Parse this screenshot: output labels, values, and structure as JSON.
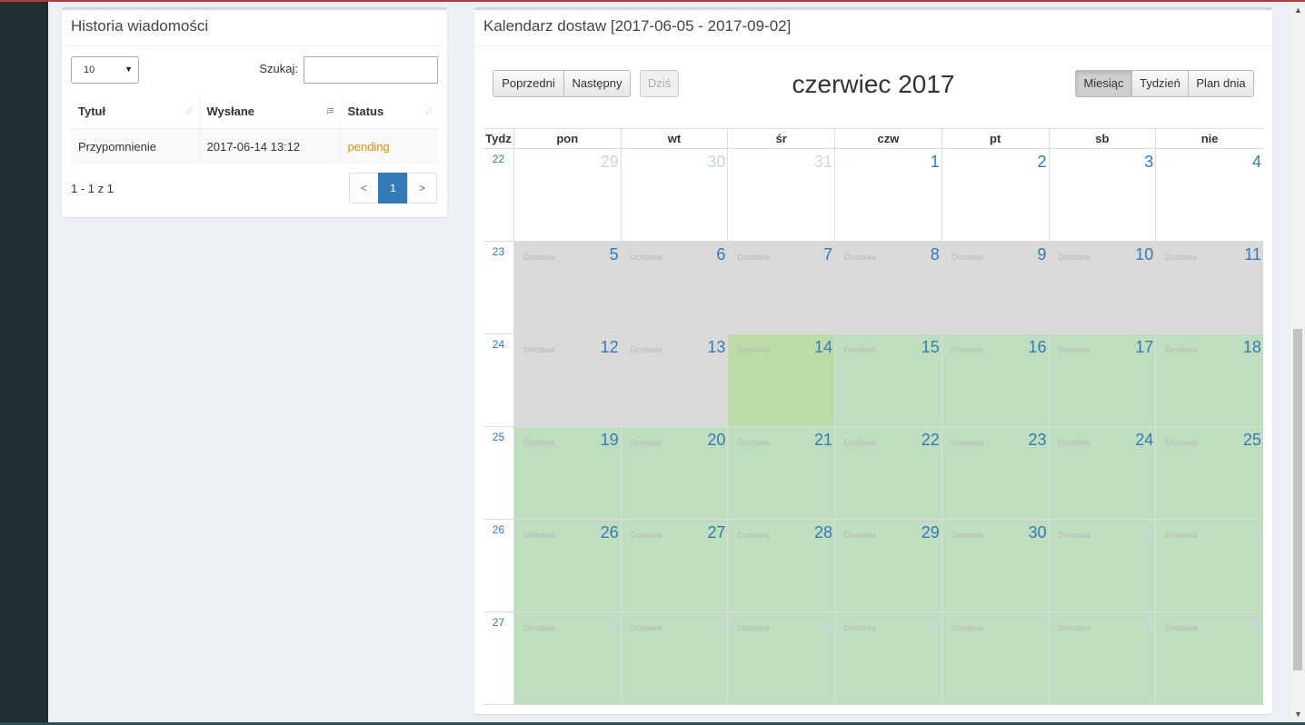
{
  "left_panel": {
    "title": "Historia wiadomości",
    "length_select": "10",
    "search_label": "Szukaj:",
    "search_value": "",
    "columns": [
      "Tytuł",
      "Wysłane",
      "Status"
    ],
    "rows": [
      {
        "title": "Przypomnienie",
        "sent": "2017-06-14 13:12",
        "status": "pending"
      }
    ],
    "info": "1 - 1 z 1",
    "pager": {
      "prev": "<",
      "page": "1",
      "next": ">"
    }
  },
  "calendar": {
    "title": "Kalendarz dostaw [2017-06-05 - 2017-09-02]",
    "month_title": "czerwiec 2017",
    "buttons": {
      "prev": "Poprzedni",
      "next": "Następny",
      "today": "Dziś",
      "month": "Miesiąc",
      "week": "Tydzień",
      "day": "Plan dnia"
    },
    "active_view": "month",
    "week_header": "Tydz",
    "weekdays": [
      "pon",
      "wt",
      "śr",
      "czw",
      "pt",
      "sb",
      "nie"
    ],
    "event_label": "Dostawa",
    "weeks": [
      {
        "no": "22",
        "days": [
          {
            "d": "29",
            "other": true,
            "state": "none",
            "ev": false
          },
          {
            "d": "30",
            "other": true,
            "state": "none",
            "ev": false
          },
          {
            "d": "31",
            "other": true,
            "state": "none",
            "ev": false
          },
          {
            "d": "1",
            "other": false,
            "state": "none",
            "ev": false
          },
          {
            "d": "2",
            "other": false,
            "state": "none",
            "ev": false
          },
          {
            "d": "3",
            "other": false,
            "state": "none",
            "ev": false
          },
          {
            "d": "4",
            "other": false,
            "state": "none",
            "ev": false
          }
        ]
      },
      {
        "no": "23",
        "days": [
          {
            "d": "5",
            "other": false,
            "state": "gray",
            "ev": true
          },
          {
            "d": "6",
            "other": false,
            "state": "gray",
            "ev": true
          },
          {
            "d": "7",
            "other": false,
            "state": "gray",
            "ev": true
          },
          {
            "d": "8",
            "other": false,
            "state": "gray",
            "ev": true
          },
          {
            "d": "9",
            "other": false,
            "state": "gray",
            "ev": true
          },
          {
            "d": "10",
            "other": false,
            "state": "gray",
            "ev": true
          },
          {
            "d": "11",
            "other": false,
            "state": "gray",
            "ev": true
          }
        ]
      },
      {
        "no": "24",
        "days": [
          {
            "d": "12",
            "other": false,
            "state": "gray",
            "ev": true
          },
          {
            "d": "13",
            "other": false,
            "state": "gray",
            "ev": true
          },
          {
            "d": "14",
            "other": false,
            "state": "today",
            "ev": true
          },
          {
            "d": "15",
            "other": false,
            "state": "green",
            "ev": true
          },
          {
            "d": "16",
            "other": false,
            "state": "green",
            "ev": true
          },
          {
            "d": "17",
            "other": false,
            "state": "green",
            "ev": true
          },
          {
            "d": "18",
            "other": false,
            "state": "green",
            "ev": true
          }
        ]
      },
      {
        "no": "25",
        "days": [
          {
            "d": "19",
            "other": false,
            "state": "green",
            "ev": true
          },
          {
            "d": "20",
            "other": false,
            "state": "green",
            "ev": true
          },
          {
            "d": "21",
            "other": false,
            "state": "green",
            "ev": true
          },
          {
            "d": "22",
            "other": false,
            "state": "green",
            "ev": true
          },
          {
            "d": "23",
            "other": false,
            "state": "green",
            "ev": true
          },
          {
            "d": "24",
            "other": false,
            "state": "green",
            "ev": true
          },
          {
            "d": "25",
            "other": false,
            "state": "green",
            "ev": true
          }
        ]
      },
      {
        "no": "26",
        "days": [
          {
            "d": "26",
            "other": false,
            "state": "green",
            "ev": true
          },
          {
            "d": "27",
            "other": false,
            "state": "green",
            "ev": true
          },
          {
            "d": "28",
            "other": false,
            "state": "green",
            "ev": true
          },
          {
            "d": "29",
            "other": false,
            "state": "green",
            "ev": true
          },
          {
            "d": "30",
            "other": false,
            "state": "green",
            "ev": true
          },
          {
            "d": "1",
            "other": true,
            "state": "green",
            "ev": true
          },
          {
            "d": "2",
            "other": true,
            "state": "green",
            "ev": true
          }
        ]
      },
      {
        "no": "27",
        "days": [
          {
            "d": "3",
            "other": true,
            "state": "green",
            "ev": true
          },
          {
            "d": "4",
            "other": true,
            "state": "green",
            "ev": true
          },
          {
            "d": "5",
            "other": true,
            "state": "green",
            "ev": true
          },
          {
            "d": "6",
            "other": true,
            "state": "green",
            "ev": true
          },
          {
            "d": "7",
            "other": true,
            "state": "green",
            "ev": true
          },
          {
            "d": "8",
            "other": true,
            "state": "green",
            "ev": true
          },
          {
            "d": "9",
            "other": true,
            "state": "green",
            "ev": true
          }
        ]
      }
    ]
  },
  "colors": {
    "sidebar": "#222d32",
    "accent": "#337ab7",
    "pending": "#e08e0b",
    "unavailable_day": "#d9d9d9",
    "available_day": "#bfddbf",
    "today": "#bcdba6"
  }
}
